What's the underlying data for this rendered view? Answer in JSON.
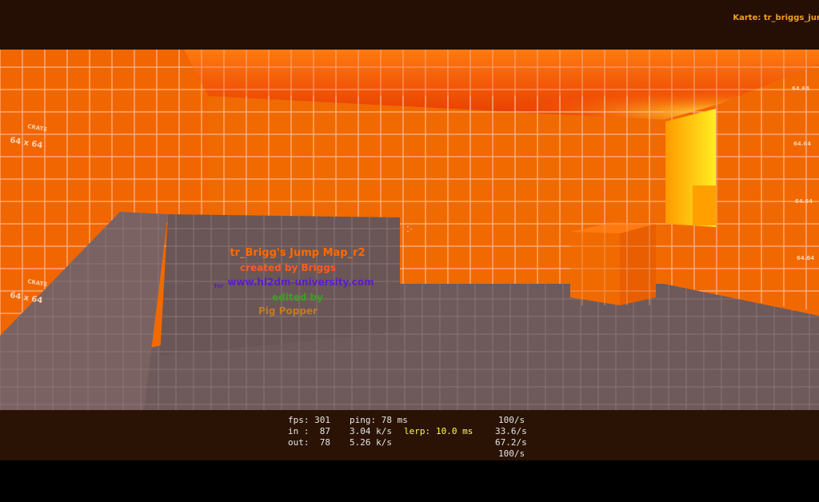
{
  "hud": {
    "map_label": "Karte: tr_briggs_jun"
  },
  "netgraph": {
    "row1": {
      "fps": "fps: 301",
      "ping": "ping: 78 ms",
      "rate": "100/s"
    },
    "row2": {
      "in_label": "in :  87",
      "in_rate": "3.04 k/s",
      "lerp_label": "lerp:",
      "lerp_value": "10.0 ms",
      "rate": "33.6/s"
    },
    "row3": {
      "out_label": "out:  78",
      "out_rate": "5.26 k/s",
      "rate": "67.2/s"
    },
    "row4": {
      "rate": "100/s"
    }
  },
  "map_credits": {
    "title": "tr_Brigg's Jump Map_r2",
    "created_by": "created by Briggs",
    "for_prefix": "for",
    "url": "www.hl2dm-university.com",
    "edited_by": "edited by",
    "editor": "Pig Popper"
  },
  "wall_labels": {
    "crate_left_top": "CRATE",
    "size_left_top": "64 x 64",
    "crate_left_bottom": "CRATE",
    "size_left_bottom": "64 x 64",
    "size_right_1": "64.64",
    "size_right_2": "64.64",
    "size_right_3": "64.64",
    "size_right_4": "64.64"
  },
  "colors": {
    "wall_orange": "#f06a00",
    "floor_gray": "#6e5a5a",
    "grid_line": "#f4b08a",
    "title_orange": "#ff6a00",
    "created_orange": "#ff5a20",
    "url_purple": "#5a1cc8",
    "edited_green": "#3aa020",
    "editor_brown": "#c07a2a",
    "map_label": "#f0a020",
    "lerp_yellow": "#ffff40"
  }
}
